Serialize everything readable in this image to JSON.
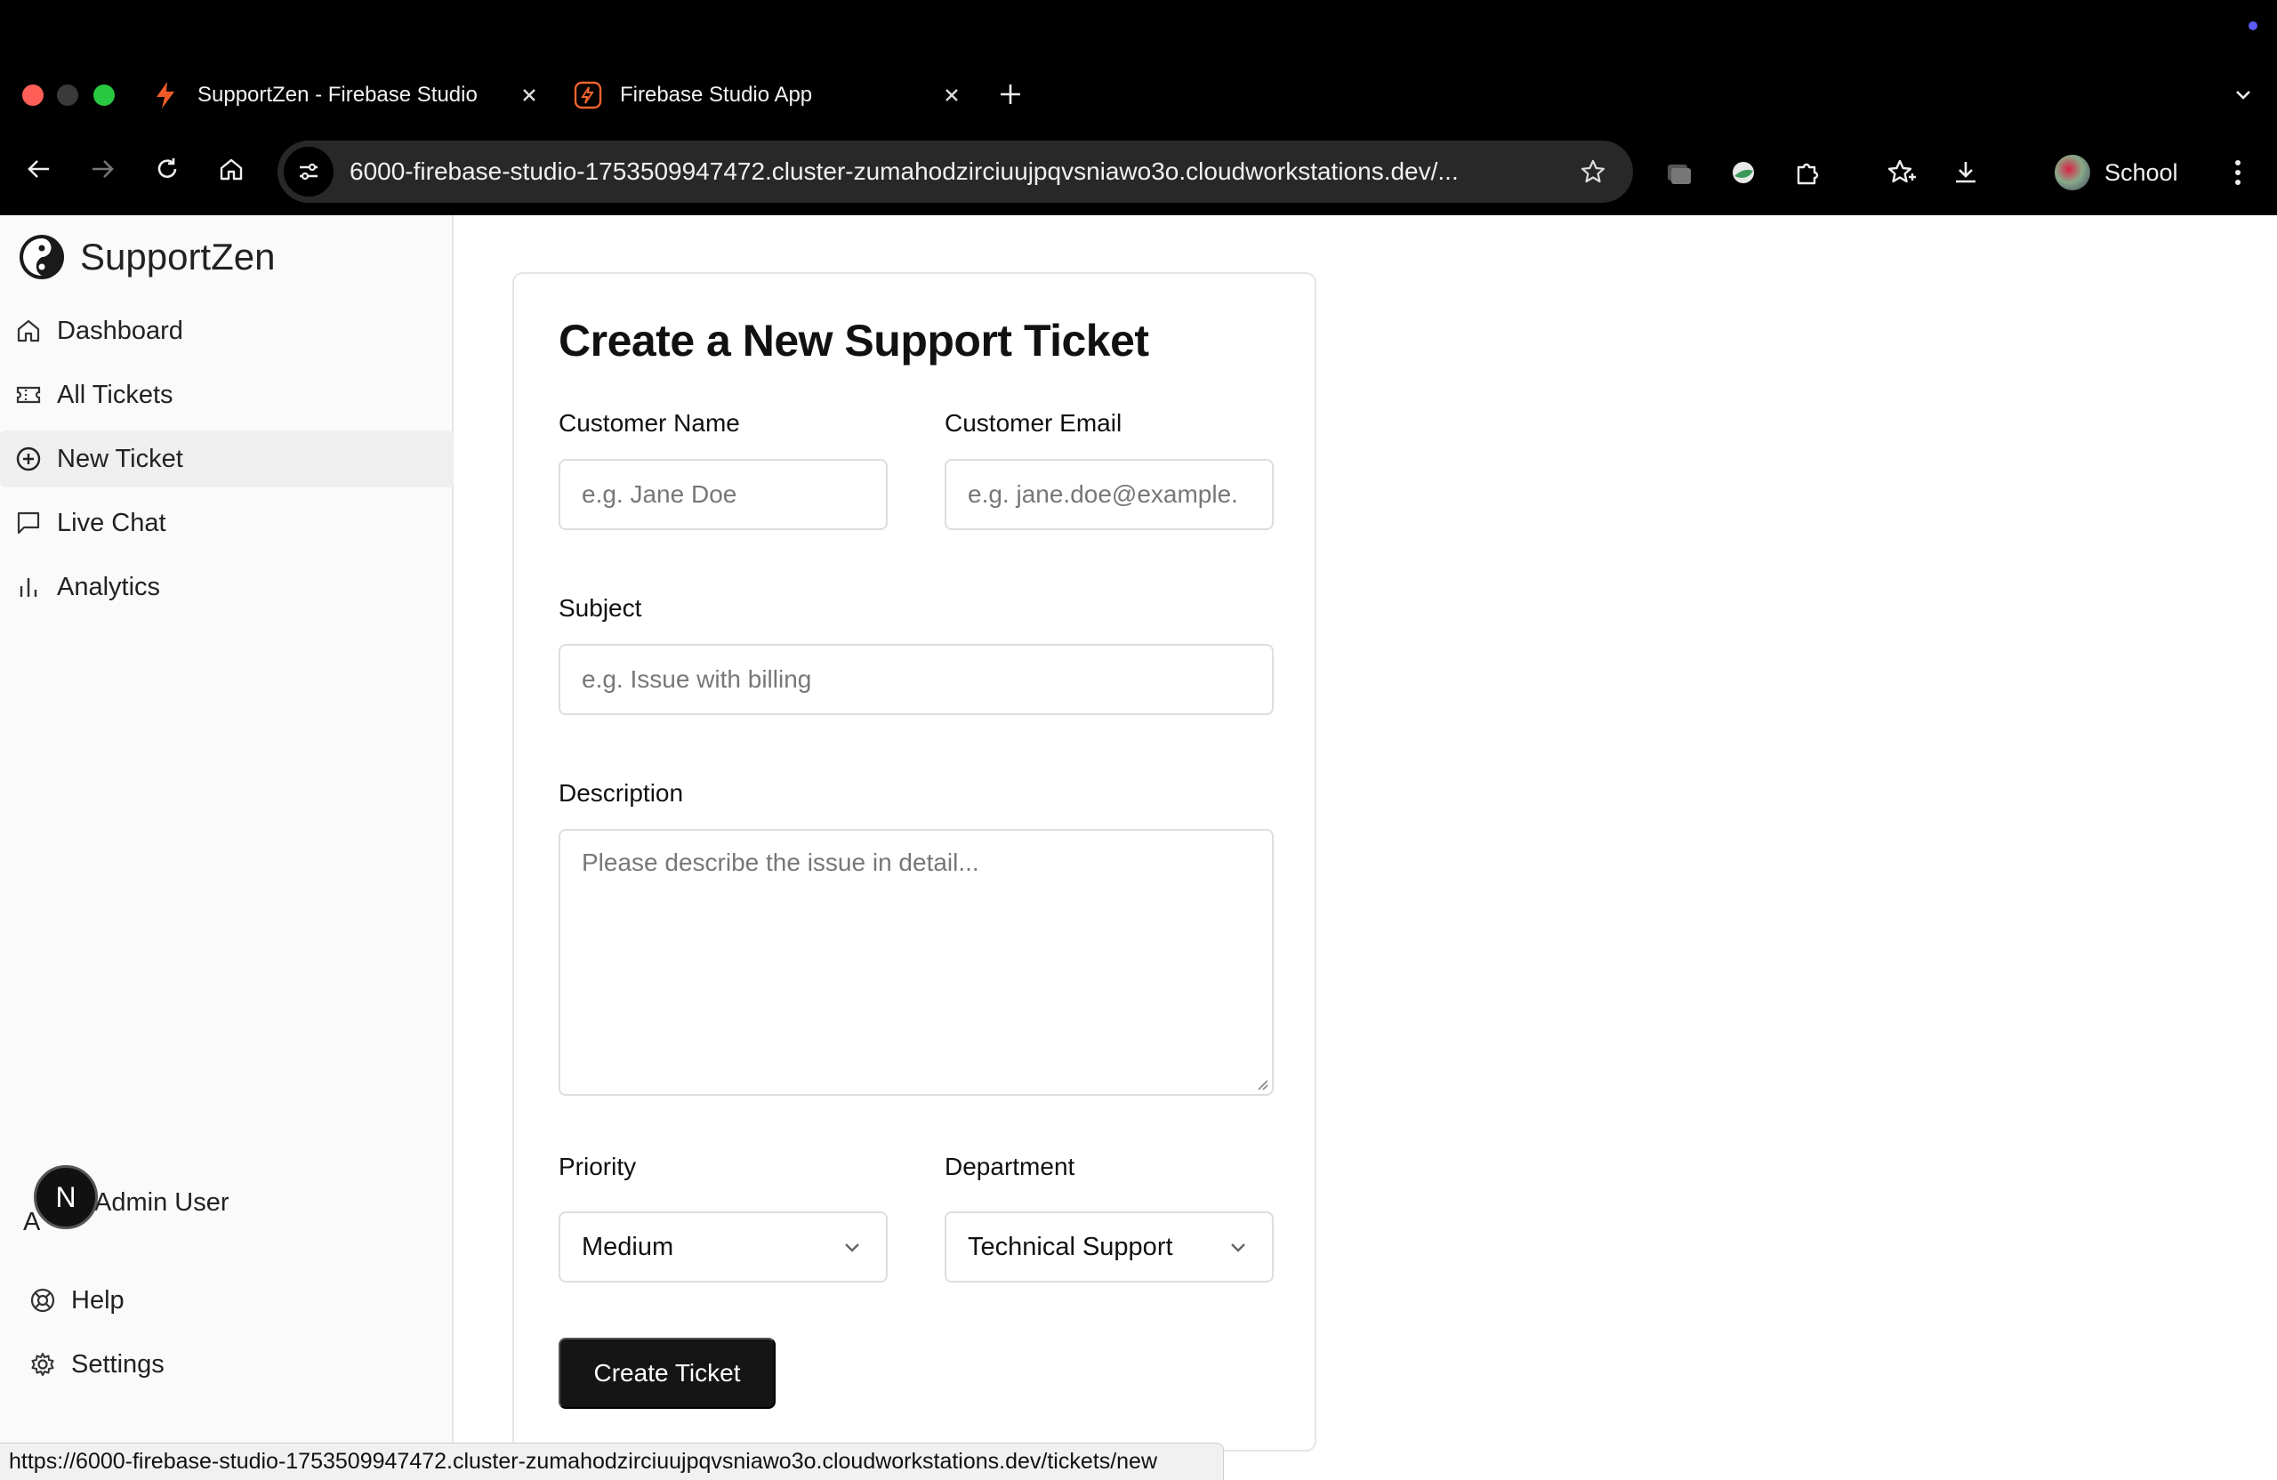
{
  "browser": {
    "tabs": [
      {
        "title": "SupportZen - Firebase Studio"
      },
      {
        "title": "Firebase Studio App"
      }
    ],
    "url": "6000-firebase-studio-1753509947472.cluster-zumahodzirciuujpqvsniawo3o.cloudworkstations.dev/...",
    "profile_name": "School",
    "status_url": "https://6000-firebase-studio-1753509947472.cluster-zumahodzirciuujpqvsniawo3o.cloudworkstations.dev/tickets/new"
  },
  "sidebar": {
    "brand": "SupportZen",
    "items": [
      {
        "label": "Dashboard",
        "icon": "home-icon"
      },
      {
        "label": "All Tickets",
        "icon": "ticket-icon"
      },
      {
        "label": "New Ticket",
        "icon": "plus-circle-icon",
        "active": true
      },
      {
        "label": "Live Chat",
        "icon": "message-icon"
      },
      {
        "label": "Analytics",
        "icon": "bar-chart-icon"
      }
    ],
    "bottom": [
      {
        "label": "Help",
        "icon": "lifebuoy-icon"
      },
      {
        "label": "Settings",
        "icon": "gear-icon"
      }
    ],
    "user": {
      "badge": "N",
      "initial": "A",
      "name": "Admin User"
    }
  },
  "form": {
    "title": "Create a New Support Ticket",
    "customer_name": {
      "label": "Customer Name",
      "placeholder": "e.g. Jane Doe"
    },
    "customer_email": {
      "label": "Customer Email",
      "placeholder": "e.g. jane.doe@example."
    },
    "subject": {
      "label": "Subject",
      "placeholder": "e.g. Issue with billing"
    },
    "description": {
      "label": "Description",
      "placeholder": "Please describe the issue in detail..."
    },
    "priority": {
      "label": "Priority",
      "value": "Medium"
    },
    "department": {
      "label": "Department",
      "value": "Technical Support"
    },
    "submit_label": "Create Ticket"
  },
  "colors": {
    "primary_button": "#151515",
    "sidebar_bg": "#fafafa",
    "active_item_bg": "#efefef"
  }
}
